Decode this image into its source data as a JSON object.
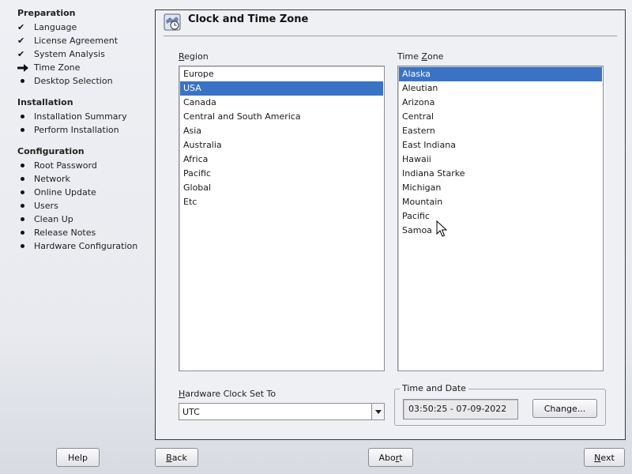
{
  "sidebar": {
    "sections": [
      {
        "title": "Preparation",
        "items": [
          {
            "label": "Language",
            "state": "done"
          },
          {
            "label": "License Agreement",
            "state": "done"
          },
          {
            "label": "System Analysis",
            "state": "done"
          },
          {
            "label": "Time Zone",
            "state": "current"
          },
          {
            "label": "Desktop Selection",
            "state": "pending"
          }
        ]
      },
      {
        "title": "Installation",
        "items": [
          {
            "label": "Installation Summary",
            "state": "pending"
          },
          {
            "label": "Perform Installation",
            "state": "pending"
          }
        ]
      },
      {
        "title": "Configuration",
        "items": [
          {
            "label": "Root Password",
            "state": "pending"
          },
          {
            "label": "Network",
            "state": "pending"
          },
          {
            "label": "Online Update",
            "state": "pending"
          },
          {
            "label": "Users",
            "state": "pending"
          },
          {
            "label": "Clean Up",
            "state": "pending"
          },
          {
            "label": "Release Notes",
            "state": "pending"
          },
          {
            "label": "Hardware Configuration",
            "state": "pending"
          }
        ]
      }
    ]
  },
  "main": {
    "title": "Clock and Time Zone",
    "region": {
      "label": "Region",
      "mnemonic": "R",
      "label_rest": "egion",
      "items": [
        "Europe",
        "USA",
        "Canada",
        "Central and South America",
        "Asia",
        "Australia",
        "Africa",
        "Pacific",
        "Global",
        "Etc"
      ],
      "selected": "USA"
    },
    "timezone": {
      "label": "Time Zone",
      "label_pre": "Time ",
      "mnemonic": "Z",
      "label_rest": "one",
      "items": [
        "Alaska",
        "Aleutian",
        "Arizona",
        "Central",
        "Eastern",
        "East Indiana",
        "Hawaii",
        "Indiana Starke",
        "Michigan",
        "Mountain",
        "Pacific",
        "Samoa"
      ],
      "selected": "Alaska"
    },
    "hardware_clock": {
      "label": "Hardware Clock Set To",
      "mnemonic": "H",
      "label_rest": "ardware Clock Set To",
      "value": "UTC"
    },
    "time_and_date": {
      "title": "Time and Date",
      "value": "03:50:25 - 07-09-2022",
      "change_label": "Change..."
    }
  },
  "buttons": {
    "help": "Help",
    "back_mnemonic": "B",
    "back_rest": "ack",
    "abort_pre": "Abo",
    "abort_mnemonic": "r",
    "abort_rest": "t",
    "next_mnemonic": "N",
    "next_rest": "ext"
  },
  "colors": {
    "selection": "#3a73c5",
    "panel_bg": "#eff0f3"
  },
  "icons": {
    "title": "clock-timezone-icon",
    "done": "checkmark-icon",
    "current": "arrow-right-icon",
    "pending": "bullet-icon",
    "cursor": "mouse-pointer-icon"
  }
}
